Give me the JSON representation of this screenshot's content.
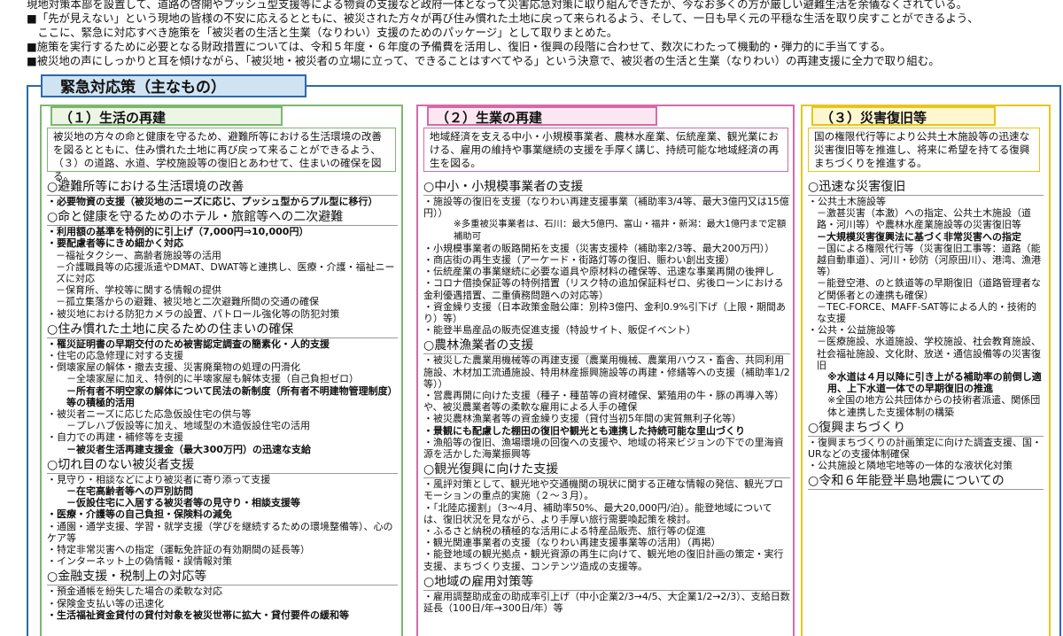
{
  "intro": [
    "現地対策本部を設置して、道路の啓開やプッシュ型支援等による物資の支援など政府一体となって災害応急対策に取り組んできたが、今なお多くの方が厳しい避難生活を余儀なくされている。",
    "■「先が見えない」という現地の皆様の不安に応えるとともに、被災された方々が再び住み慣れた土地に戻って来られるよう、そして、一日も早く元の平穏な生活を取り戻すことができるよう、",
    "　ここに、緊急に対応すべき施策を「被災者の生活と生業（なりわい）支援のためのパッケージ」として取りまとめた。",
    "■施策を実行するために必要となる財政措置については、令和５年度・６年度の予備費を活用し、復旧・復興の段階に合わせて、数次にわたって機動的・弾力的に手当てする。",
    "■被災地の声にしっかりと耳を傾けながら、「被災地・被災者の立場に立って、できることはすべてやる」という決意で、被災者の生活と生業（なりわい）の再建支援に全力で取り組む。"
  ],
  "main_title": "緊急対応策（主なもの）",
  "col1": {
    "title": "（１）生活の再建",
    "desc": "被災地の方々の命と健康を守るため、避難所等における生活環境の改善を図るとともに、住み慣れた土地に再び戻って来ることができるよう、（３）の道路、水道、学校施設等の復旧とあわせて、住まいの確保を図る。",
    "lines": [
      {
        "t": "○避難所等における生活環境の改善",
        "c": "sec"
      },
      {
        "t": "・必要物資の支援（被災地のニーズに応じ、プッシュ型からプル型に移行）",
        "c": "item b"
      },
      {
        "t": "○命と健康を守るためのホテル・旅館等への二次避難",
        "c": "sec"
      },
      {
        "t": "・利用額の基準を特例的に引上げ（7,000円⇒10,000円）",
        "c": "item b"
      },
      {
        "t": "・要配慮者等にきめ細かく対応",
        "c": "item b"
      },
      {
        "t": "－福祉タクシー、高齢者施設等の活用",
        "c": "item ind1"
      },
      {
        "t": "－介護職員等の応援派遣やDMAT、DWAT等と連携し、医療・介護・福祉ニーズに対応",
        "c": "item ind1"
      },
      {
        "t": "－保育所、学校等に関する情報の提供",
        "c": "item ind1"
      },
      {
        "t": "－孤立集落からの避難、被災地と二次避難所間の交通の確保",
        "c": "item ind1"
      },
      {
        "t": "・被災地における防犯カメラの設置、パトロール強化等の防犯対策",
        "c": "item"
      },
      {
        "t": "○住み慣れた土地に戻るための住まいの確保",
        "c": "sec"
      },
      {
        "t": "・罹災証明書の早期交付のため被害認定調査の簡素化・人的支援",
        "c": "item b"
      },
      {
        "t": "・住宅の応急修理に対する支援",
        "c": "item"
      },
      {
        "t": "・倒壊家屋の解体・撤去支援、災害廃棄物の処理の円滑化",
        "c": "item"
      },
      {
        "t": "－全壊家屋に加え、特例的に半壊家屋も解体支援（自己負担ゼロ）",
        "c": "item ind2"
      },
      {
        "t": "－所有者不明空家の解体について民法の新制度（所有者不明建物管理制度）等の積極的活用",
        "c": "item ind2 b"
      },
      {
        "t": "・被災者ニーズに応じた応急仮設住宅の供与等",
        "c": "item"
      },
      {
        "t": "－プレハブ仮設等に加え、地域型の木造仮設住宅の活用",
        "c": "item ind2"
      },
      {
        "t": "・自力での再建・補修等を支援",
        "c": "item"
      },
      {
        "t": "－被災者生活再建支援金（最大300万円）の迅速な支給",
        "c": "item ind2 b"
      },
      {
        "t": "○切れ目のない被災者支援",
        "c": "sec"
      },
      {
        "t": "・見守り・相談などにより被災者に寄り添って支援",
        "c": "item"
      },
      {
        "t": "－在宅高齢者等への戸別訪問",
        "c": "item ind2 b"
      },
      {
        "t": "－仮設住宅に入居する被災者等の見守り・相談支援等",
        "c": "item ind2 b"
      },
      {
        "t": "・医療・介護等の自己負担・保険料の減免",
        "c": "item b"
      },
      {
        "t": "・通園・通学支援、学習・就学支援（学びを継続するための環境整備等）、心のケア等",
        "c": "item"
      },
      {
        "t": "・特定非常災害への指定（運転免許証の有効期間の延長等）",
        "c": "item"
      },
      {
        "t": "・インターネット上の偽情報・誤情報対策",
        "c": "item"
      },
      {
        "t": "○金融支援・税制上の対応等",
        "c": "sec"
      },
      {
        "t": "・預金通帳を紛失した場合の柔軟な対応",
        "c": "item"
      },
      {
        "t": "・保険金支払い等の迅速化",
        "c": "item"
      },
      {
        "t": "・生活福祉資金貸付の貸付対象を被災世帯に拡大・貸付要件の緩和等",
        "c": "item b"
      }
    ]
  },
  "col2": {
    "title": "（２）生業の再建",
    "desc": "地域経済を支える中小・小規模事業者、農林水産業、伝統産業、観光業における、雇用の維持や事業継続の支援を手厚く講じ、持続可能な地域経済の再生を図る。",
    "lines": [
      {
        "t": "○中小・小規模事業者の支援",
        "c": "sec"
      },
      {
        "t": "・施設等の復旧を支援（なりわい再建支援事業（補助率3/4等、最大3億円又は15億円））",
        "c": "item"
      },
      {
        "t": "※多重被災事業者は、石川：最大5億円、富山・福井・新潟：最大1億円まで定額補助可",
        "c": "item ind3 small"
      },
      {
        "t": "・小規模事業者の販路開拓を支援（災害支援枠（補助率2/3等、最大200万円））",
        "c": "item"
      },
      {
        "t": "・商店街の再生支援（アーケード・街路灯等の復旧、賑わい創出支援）",
        "c": "item"
      },
      {
        "t": "・伝統産業の事業継続に必要な道具や原材料の確保等、迅速な事業再開の後押し",
        "c": "item"
      },
      {
        "t": "・コロナ借換保証等の特例措置（リスク特の追加保証料ゼロ、劣後ローンにおける金利優遇措置、二重債務問題への対応等）",
        "c": "item"
      },
      {
        "t": "・資金繰り支援（日本政策金融公庫：別枠3億円、金利0.9%引下げ（上限・期間あり）等）",
        "c": "item"
      },
      {
        "t": "・能登半島産品の販売促進支援（特設サイト、販促イベント）",
        "c": "item"
      },
      {
        "t": "○農林漁業者の支援",
        "c": "sec"
      },
      {
        "t": "・被災した農業用機械等の再建支援（農業用機械、農業用ハウス・畜舎、共同利用施設、木材加工流通施設、特用林産振興施設等の再建・修繕等への支援（補助率1/2等））",
        "c": "item"
      },
      {
        "t": "・営農再開に向けた支援（種子・種苗等の資材確保、繁殖用の牛・豚の再導入等）や、被災農業者等の柔軟な雇用による人手の確保",
        "c": "item"
      },
      {
        "t": "・被災農林漁業者等の資金繰り支援（貸付当初5年間の実質無利子化等）",
        "c": "item"
      },
      {
        "t": "・景観にも配慮した棚田の復旧や観光とも連携した持続可能な里山づくり",
        "c": "item b"
      },
      {
        "t": "・漁船等の復旧、漁場環境の回復への支援や、地域の将来ビジョンの下での里海資源を活かした海業振興等",
        "c": "item"
      },
      {
        "t": "○観光復興に向けた支援",
        "c": "sec"
      },
      {
        "t": "・風評対策として、観光地や交通機関の現状に関する正確な情報の発信、観光プロモーションの重点的実施（２～３月）。",
        "c": "item"
      },
      {
        "t": "・「北陸応援割」（3～4月、補助率50%、最大20,000円/泊）。能登地域については、復旧状況を見ながら、より手厚い旅行需要喚起策を検討。",
        "c": "item"
      },
      {
        "t": "・ふるさと納税の積極的な活用による特産品販売、旅行等の促進",
        "c": "item"
      },
      {
        "t": "・観光関連事業者の支援（なりわい再建支援事業等の活用）（再掲）",
        "c": "item"
      },
      {
        "t": "・能登地域の観光拠点・観光資源の再生に向けて、観光地の復旧計画の策定・実行支援、まちづくり支援、コンテンツ造成の支援等。",
        "c": "item"
      },
      {
        "t": "○地域の雇用対策等",
        "c": "sec"
      },
      {
        "t": "・雇用調整助成金の助成率引上げ（中小企業2/3→4/5、大企業1/2→2/3）、支給日数延長（100日/年→300日/年）等",
        "c": "item"
      }
    ]
  },
  "col3": {
    "title": "（３）災害復旧等",
    "desc": "国の権限代行等により公共土木施設等の迅速な災害復旧等を推進し、将来に希望を持てる復興まちづくりを推進する。",
    "lines": [
      {
        "t": "○迅速な災害復旧",
        "c": "sec"
      },
      {
        "t": "・公共土木施設等",
        "c": "item"
      },
      {
        "t": "－激甚災害（本激）への指定、公共土木施設（道路・河川等）や農林水産業施設等の災害復旧等",
        "c": "item ind1"
      },
      {
        "t": "－大規模災害復興法に基づく非常災害への指定",
        "c": "item ind1 b"
      },
      {
        "t": "－国による権限代行等（災害復旧工事等：道路（能越自動車道）、河川・砂防（河原田川）、港湾、漁港等）",
        "c": "item ind1"
      },
      {
        "t": "－能登空港、のと鉄道等の早期復旧（道路管理者など関係者との連携も確保）",
        "c": "item ind1"
      },
      {
        "t": "－TEC-FORCE、MAFF-SAT等による人的・技術的な支援",
        "c": "item ind1"
      },
      {
        "t": "・公共・公益施設等",
        "c": "item"
      },
      {
        "t": "－医療施設、水道施設、学校施設、社会教育施設、社会福祉施設、文化財、放送・通信設備等の災害復旧",
        "c": "item ind1"
      },
      {
        "t": "※水道は４月以降に引き上がる補助率の前倒し適用、上下水道一体での早期復旧の推進",
        "c": "item ind2 b"
      },
      {
        "t": "※全国の地方公共団体からの技術者派遣、関係団体と連携した支援体制の構築",
        "c": "item ind2"
      },
      {
        "t": "○復興まちづくり",
        "c": "sec"
      },
      {
        "t": "・復興まちづくりの計画策定に向けた調査支援、国・URなどの支援体制確保",
        "c": "item"
      },
      {
        "t": "・公共施設と隣地宅地等の一体的な液状化対策",
        "c": "item"
      },
      {
        "t": "○令和６年能登半島地震についての",
        "c": "sec"
      }
    ]
  }
}
